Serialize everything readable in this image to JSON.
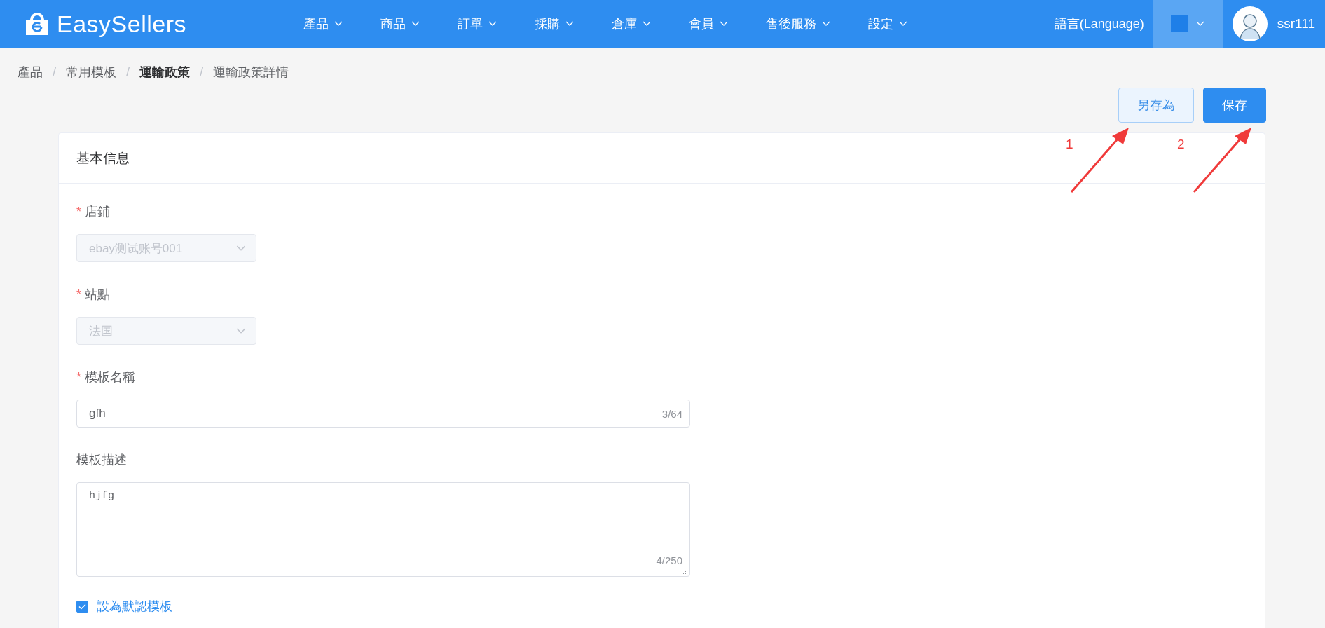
{
  "header": {
    "logo": "EasySellers",
    "nav": [
      {
        "label": "產品"
      },
      {
        "label": "商品"
      },
      {
        "label": "訂單"
      },
      {
        "label": "採購"
      },
      {
        "label": "倉庫"
      },
      {
        "label": "會員"
      },
      {
        "label": "售後服務"
      },
      {
        "label": "設定"
      }
    ],
    "language": "語言(Language)",
    "user": "ssr111"
  },
  "breadcrumb": [
    {
      "label": "產品",
      "current": false
    },
    {
      "separator_before": "/",
      "label": "常用模板",
      "current": false
    },
    {
      "separator_before": "/",
      "label": "運輸政策",
      "current": true
    },
    {
      "separator_before": "/",
      "label": "運輸政策詳情",
      "current": false
    }
  ],
  "actions": [
    {
      "label": "另存為",
      "kind": "secondary"
    },
    {
      "label": "保存",
      "kind": "primary"
    }
  ],
  "annotations": [
    {
      "label": "1"
    },
    {
      "label": "2"
    }
  ],
  "card": {
    "title": "基本信息",
    "fields": [
      {
        "kind": "select",
        "required_mark": "*",
        "label": "店鋪",
        "value": "ebay测试账号001",
        "disabled": true
      },
      {
        "kind": "select",
        "required_mark": "*",
        "label": "站點",
        "value": "法国",
        "disabled": true
      },
      {
        "kind": "input",
        "required_mark": "*",
        "label": "模板名稱",
        "value": "gfh",
        "count": "3/64"
      },
      {
        "kind": "textarea",
        "label": "模板描述",
        "value": "hjfg",
        "count": "4/250"
      }
    ],
    "default_checkbox": {
      "label": "設為默認模板",
      "checked": true
    }
  }
}
